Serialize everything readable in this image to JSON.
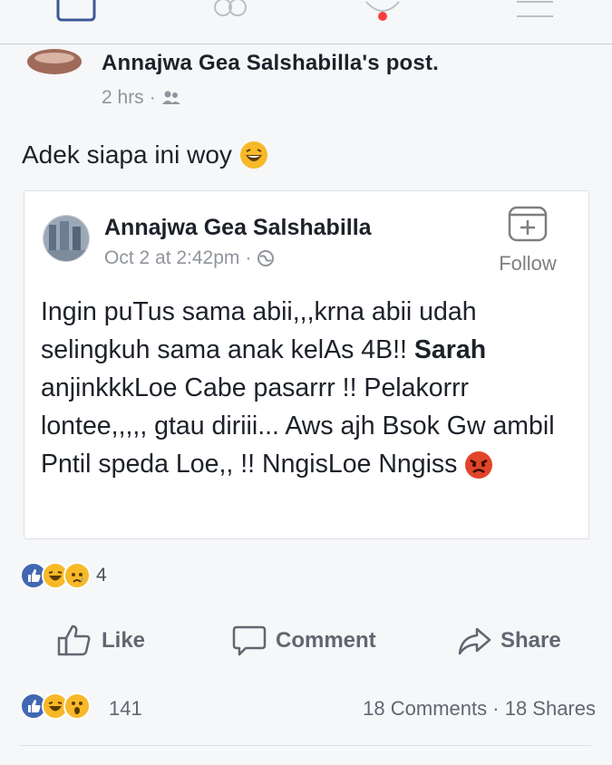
{
  "nav": {
    "icons": [
      "news-feed-icon",
      "friends-icon",
      "notifications-icon",
      "menu-icon"
    ]
  },
  "shared": {
    "title": "Annajwa Gea Salshabilla's post.",
    "time": "2 hrs",
    "separator": "·"
  },
  "caption": {
    "text": "Adek siapa ini woy"
  },
  "post": {
    "author": "Annajwa Gea Salshabilla",
    "time": "Oct 2 at 2:42pm",
    "separator": "·",
    "follow": "Follow",
    "text_part1": "Ingin puTus sama abii,,,krna abii udah selingkuh sama anak kelAs 4B!! ",
    "text_bold": "Sarah",
    "text_part2": " anjinkkkLoe Cabe pasarrr !! Pelakorrr lontee,,,,, gtau diriii... Aws ajh Bsok Gw ambil Pntil speda Loe,, !! NngisLoe Nngiss "
  },
  "shared_reactions": {
    "count": "4"
  },
  "actions": {
    "like": "Like",
    "comment": "Comment",
    "share": "Share"
  },
  "stats": {
    "reactions_count": "141",
    "comments": "18 Comments",
    "separator": "·",
    "shares": "18 Shares"
  },
  "colors": {
    "like_blue": "#3b5998",
    "reaction_yellow": "#f7b928",
    "angry_red": "#e0452a",
    "text_gray": "#90949c"
  }
}
